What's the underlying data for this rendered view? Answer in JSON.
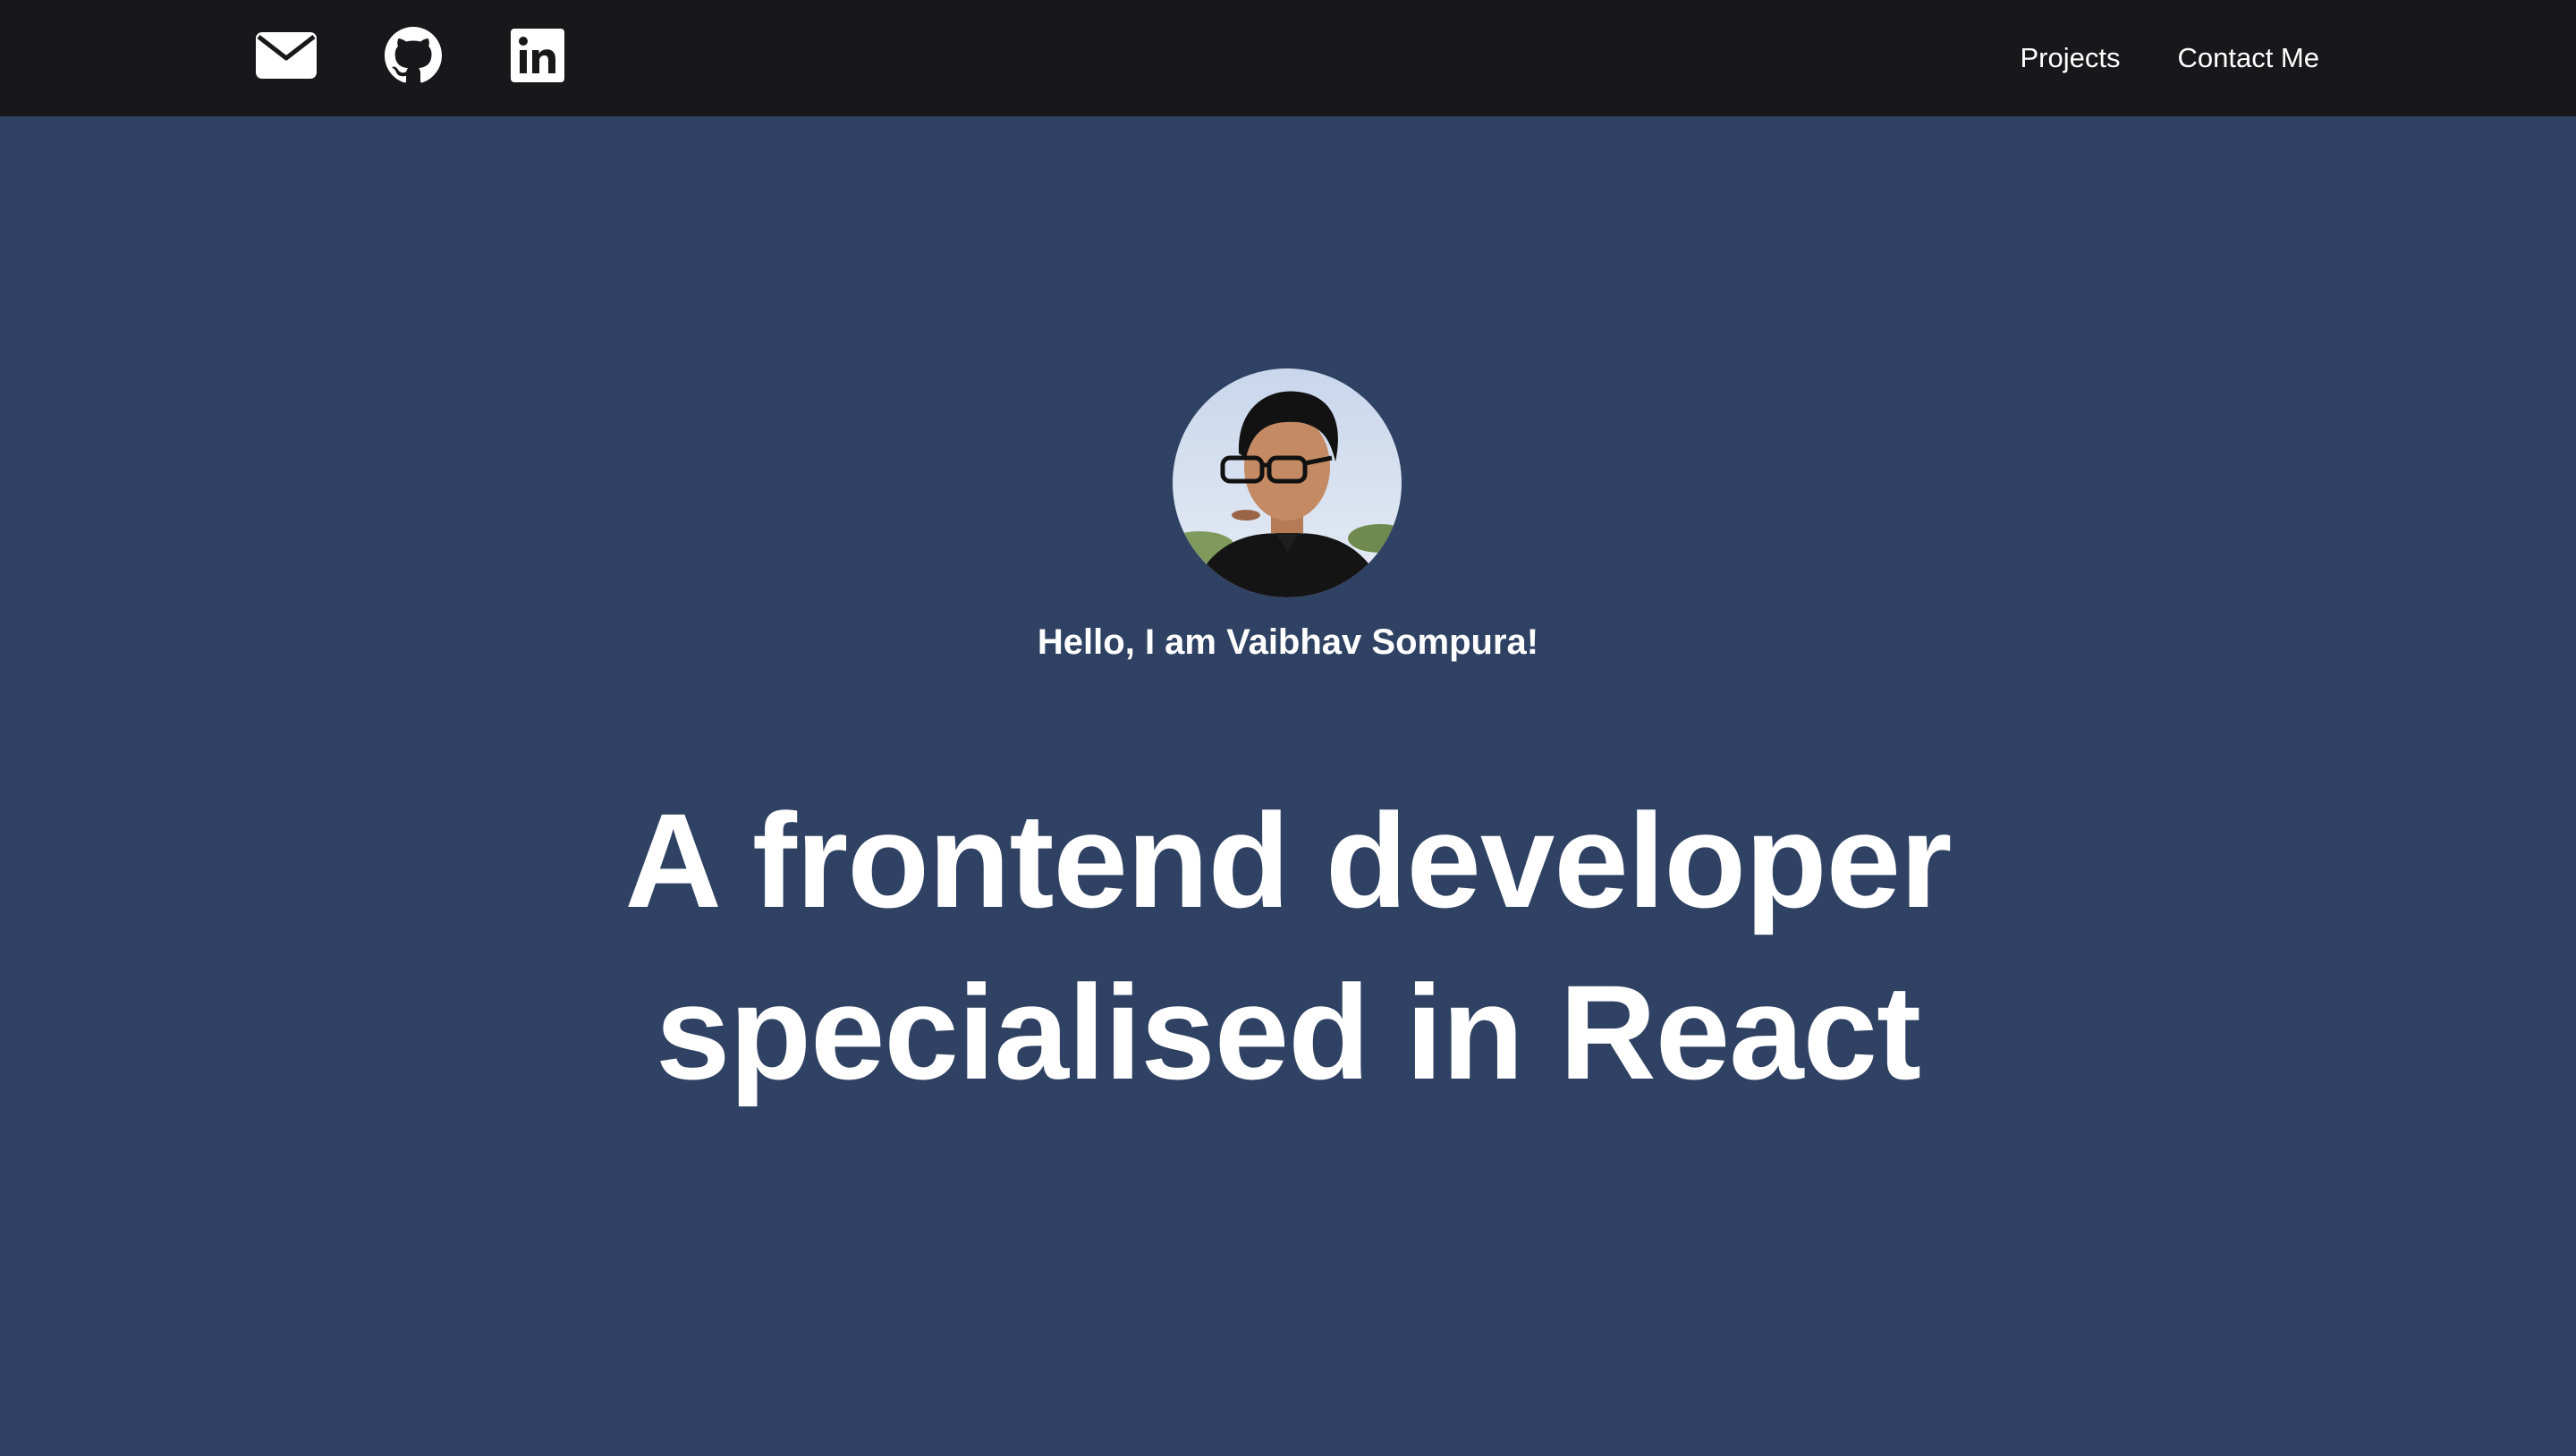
{
  "colors": {
    "page_background": "#2f4263",
    "navbar_background": "#18181b",
    "text": "#ffffff"
  },
  "navbar": {
    "social_icons": [
      "mail-icon",
      "github-icon",
      "linkedin-icon"
    ],
    "links": [
      {
        "label": "Projects"
      },
      {
        "label": "Contact Me"
      }
    ]
  },
  "hero": {
    "avatar_icon": "profile-photo",
    "greeting": "Hello, I am Vaibhav Sompura!",
    "headline_line_1": "A frontend developer",
    "headline_line_2": "specialised in React"
  }
}
